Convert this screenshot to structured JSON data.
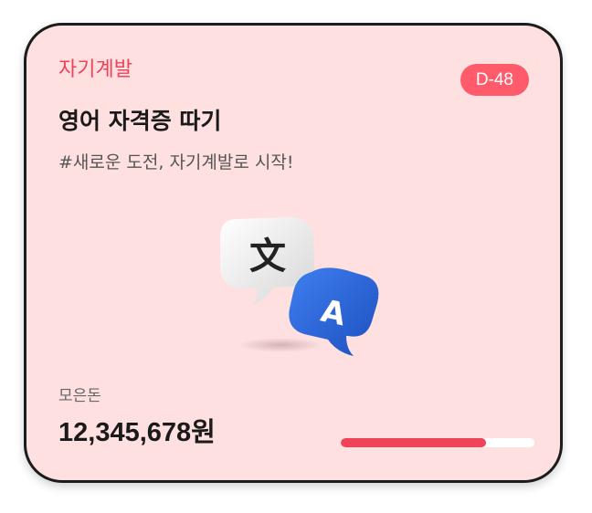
{
  "card": {
    "category": "자기계발",
    "dday_badge": "D-48",
    "title": "영어 자격증 따기",
    "subtitle": "#새로운 도전, 자기계발로 시작!",
    "illustration_icon": "translate-icon",
    "saved_label": "모은돈",
    "saved_amount": "12,345,678원",
    "progress_fraction": 0.75
  },
  "colors": {
    "card_background": "#ffe0e0",
    "accent": "#f0435a",
    "badge": "#ff5b6a",
    "progress_track": "#ffffff",
    "translate_bubble_blue": "#2f6be0"
  }
}
